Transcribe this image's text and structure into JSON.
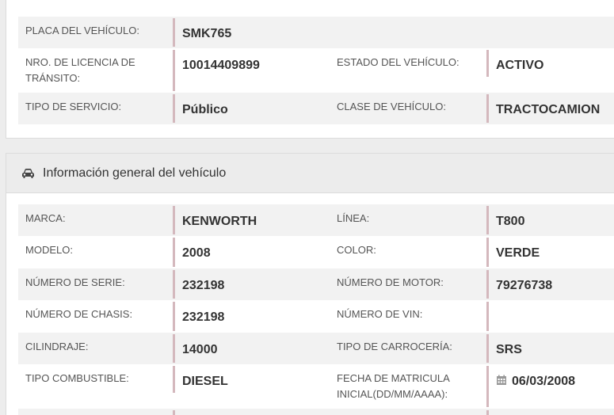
{
  "registro": {
    "placa_label": "PLACA DEL VEHÍCULO:",
    "placa_value": "SMK765",
    "licencia_label": "NRO. DE LICENCIA DE TRÁNSITO:",
    "licencia_value": "10014409899",
    "estado_label": "ESTADO DEL VEHÍCULO:",
    "estado_value": "ACTIVO",
    "servicio_label": "TIPO DE SERVICIO:",
    "servicio_value": "Público",
    "clase_label": "CLASE DE VEHÍCULO:",
    "clase_value": "TRACTOCAMION"
  },
  "general": {
    "heading": "Información general del vehículo",
    "icon": "car-icon",
    "rows": [
      {
        "l1": "MARCA:",
        "v1": "KENWORTH",
        "l2": "LÍNEA:",
        "v2": "T800"
      },
      {
        "l1": "MODELO:",
        "v1": "2008",
        "l2": "COLOR:",
        "v2": "VERDE"
      },
      {
        "l1": "NÚMERO DE SERIE:",
        "v1": "232198",
        "l2": "NÚMERO DE MOTOR:",
        "v2": "79276738"
      },
      {
        "l1": "NÚMERO DE CHASIS:",
        "v1": "232198",
        "l2": "NÚMERO DE VIN:",
        "v2": ""
      },
      {
        "l1": "CILINDRAJE:",
        "v1": "14000",
        "l2": "TIPO DE CARROCERÍA:",
        "v2": "SRS"
      },
      {
        "l1": "TIPO COMBUSTIBLE:",
        "v1": "DIESEL",
        "l2": "FECHA DE MATRICULA INICIAL(DD/MM/AAAA):",
        "v2": "06/03/2008",
        "v2_icon": "calendar-icon"
      }
    ]
  },
  "colors": {
    "accent_border": "#d4b8bd",
    "stripe": "#f2f2f2",
    "heading_bg": "#ececec"
  }
}
